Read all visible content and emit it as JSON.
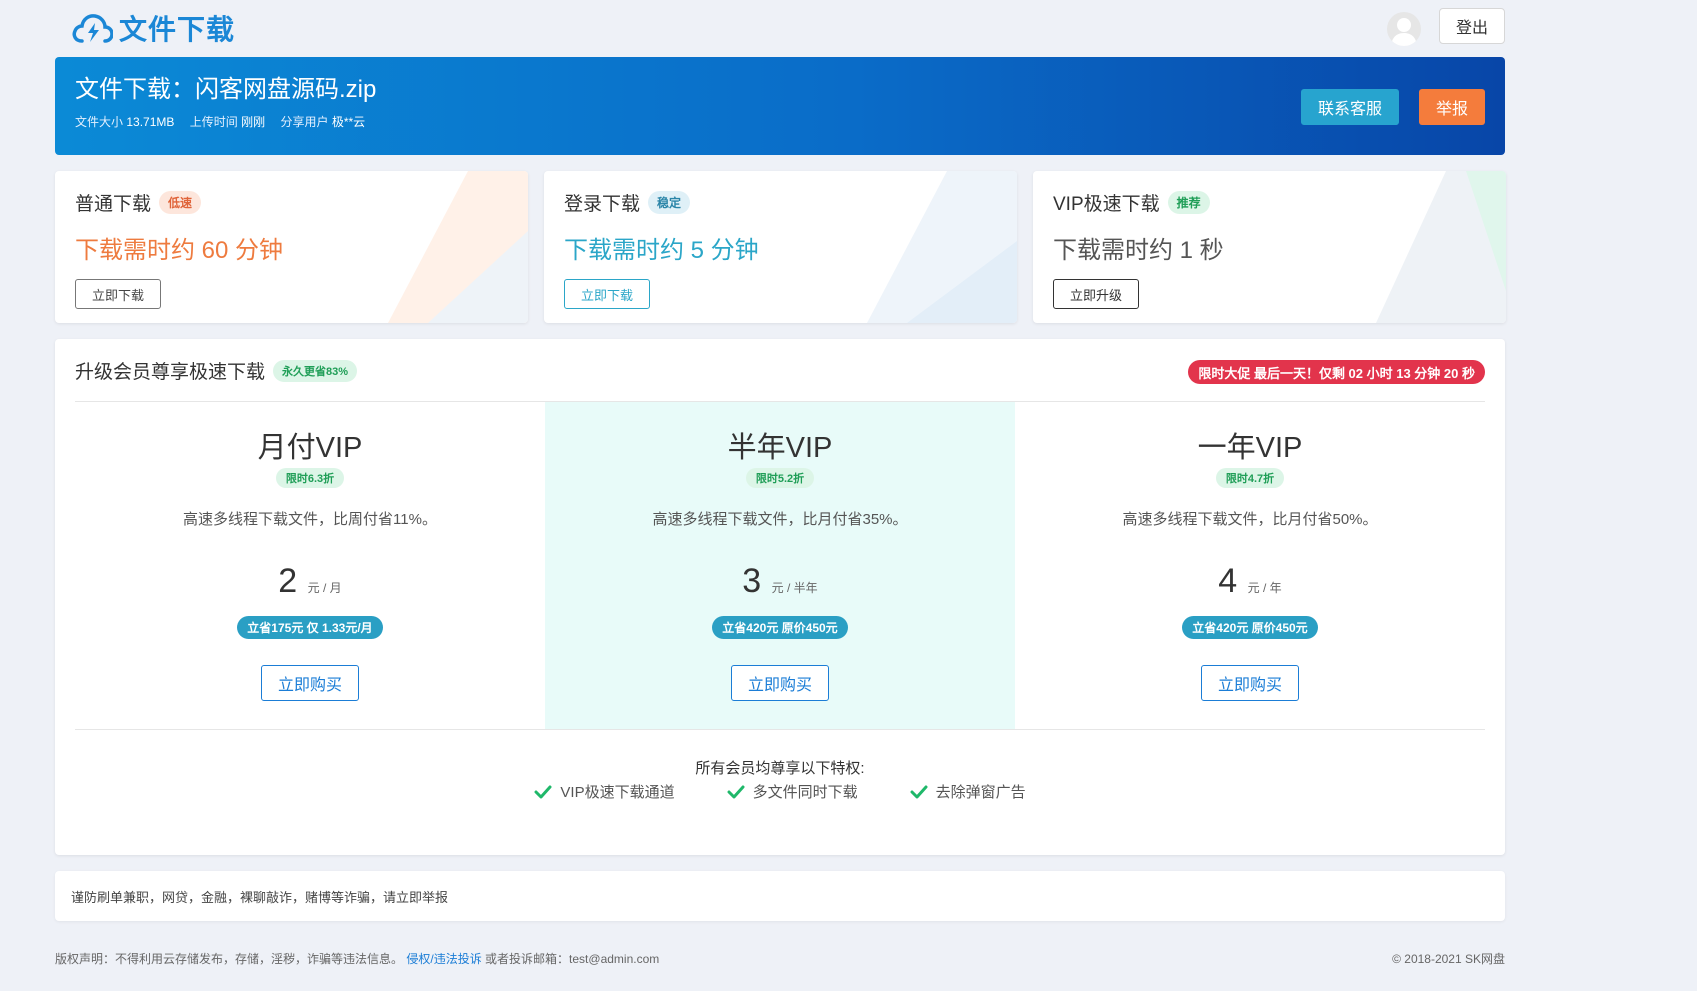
{
  "header": {
    "logo_text": "文件下载",
    "logout_label": "登出"
  },
  "banner": {
    "title": "文件下载：闪客网盘源码.zip",
    "size_label": "文件大小",
    "size_value": "13.71MB",
    "upload_label": "上传时间",
    "upload_value": "刚刚",
    "user_label": "分享用户",
    "user_value": "极**云",
    "service_button": "联系客服",
    "report_button": "举报"
  },
  "cards": [
    {
      "title": "普通下载",
      "badge": "低速",
      "time": "下载需时约 60 分钟",
      "button": "立即下载"
    },
    {
      "title": "登录下载",
      "badge": "稳定",
      "time": "下载需时约 5 分钟",
      "button": "立即下载"
    },
    {
      "title": "VIP极速下载",
      "badge": "推荐",
      "time": "下载需时约 1 秒",
      "button": "立即升级"
    }
  ],
  "vip": {
    "title": "升级会员尊享极速下载",
    "title_badge": "永久更省83%",
    "countdown": "限时大促 最后一天！仅剩 02 小时 13 分钟 20 秒",
    "plans": [
      {
        "name": "月付VIP",
        "discount": "限时6.3折",
        "desc": "高速多线程下载文件，比周付省11%。",
        "price": "2",
        "unit": "元 / 月",
        "save": "立省175元 仅 1.33元/月",
        "buy": "立即购买"
      },
      {
        "name": "半年VIP",
        "discount": "限时5.2折",
        "desc": "高速多线程下载文件，比月付省35%。",
        "price": "3",
        "unit": "元 / 半年",
        "save": "立省420元 原价450元",
        "buy": "立即购买"
      },
      {
        "name": "一年VIP",
        "discount": "限时4.7折",
        "desc": "高速多线程下载文件，比月付省50%。",
        "price": "4",
        "unit": "元 / 年",
        "save": "立省420元 原价450元",
        "buy": "立即购买"
      }
    ],
    "perks_title": "所有会员均尊享以下特权:",
    "perks": [
      "VIP极速下载通道",
      "多文件同时下载",
      "去除弹窗广告"
    ]
  },
  "notice": "谨防刷单兼职，网贷，金融，裸聊敲诈，赌博等诈骗，请立即举报",
  "footer": {
    "disclaimer": "版权声明：不得利用云存储发布，存储，淫秽，诈骗等违法信息。",
    "complaint_link": "侵权/违法投诉",
    "email_text": "或者投诉邮箱：test@admin.com",
    "copyright": "© 2018-2021 SK网盘"
  },
  "colors": {
    "brand": "#1b87d6",
    "banner_start": "#0b8ad6",
    "banner_end": "#0846a8",
    "orange": "#ee7b3f",
    "teal": "#2ba6c8",
    "countdown_red": "#e2344c",
    "success_green": "#1f9e57"
  },
  "icons": {
    "logo": "cloud-lightning-icon",
    "avatar": "user-avatar-icon",
    "perk": "check-icon"
  }
}
